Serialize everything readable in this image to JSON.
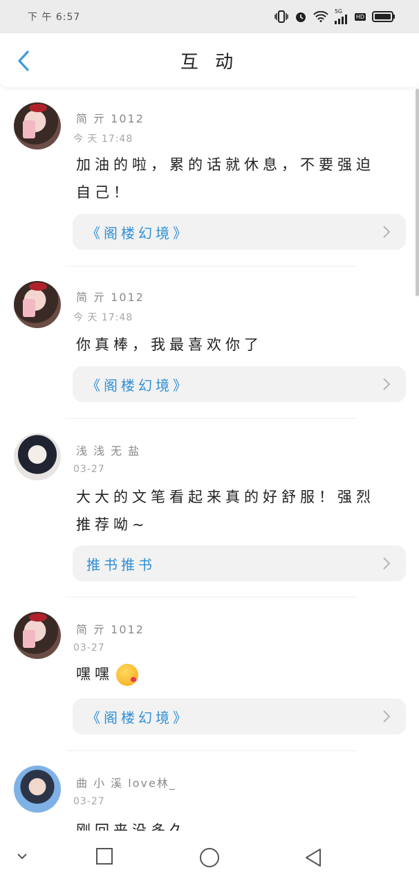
{
  "status_bar": {
    "time": "下 午 6:57",
    "network": "5G",
    "hd_label": "HD"
  },
  "header": {
    "title": "互 动"
  },
  "items": [
    {
      "name": "简 亓 1012",
      "time": "今 天  17:48",
      "content_lines": [
        "加油的啦，累的话就休息，不要强迫",
        "自己！"
      ],
      "book": "《阁楼幻境》"
    },
    {
      "name": "简 亓 1012",
      "time": "今 天  17:48",
      "content_lines": [
        "你真棒，我最喜欢你了"
      ],
      "book": "《阁楼幻境》"
    },
    {
      "name": "浅 浅 无 盐",
      "time": "03-27",
      "content_lines": [
        "大大的文笔看起来真的好舒服！强烈",
        "推荐呦~"
      ],
      "book": "推书推书"
    },
    {
      "name": "简 亓 1012",
      "time": "03-27",
      "content_lines": [
        "嘿嘿"
      ],
      "book": "《阁楼幻境》"
    },
    {
      "name": "曲 小 溪 love林_",
      "time": "03-27",
      "content_lines": [
        "刚回来没多久"
      ]
    }
  ],
  "colors": {
    "accent": "#2f8fd6",
    "back_icon": "#3a9be0",
    "card_bg": "#f2f2f2"
  }
}
